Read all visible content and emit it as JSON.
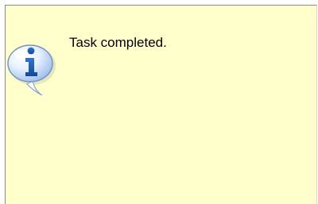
{
  "dialog": {
    "message": "Task completed.",
    "icon": "info-balloon-icon",
    "background_color": "#ffffcc",
    "icon_color": "#1f5fb0"
  }
}
